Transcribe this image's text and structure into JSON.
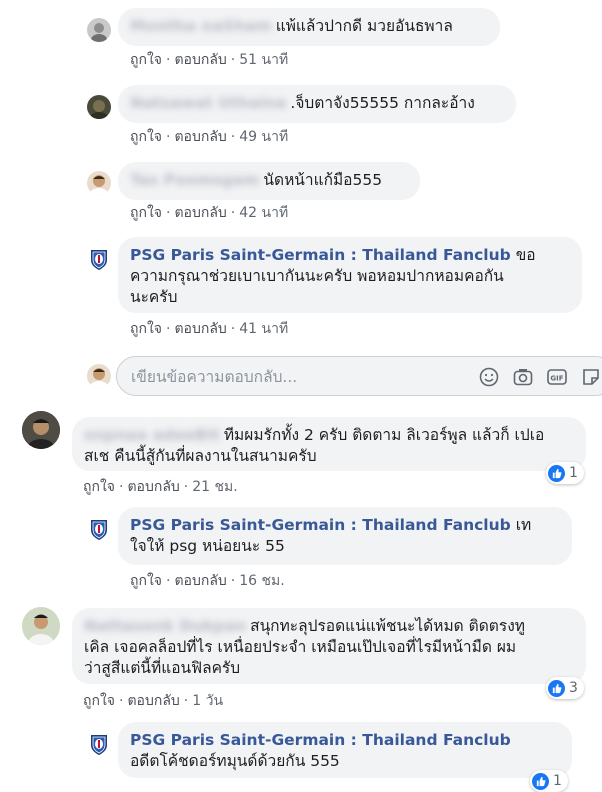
{
  "colors": {
    "link_blue": "#385898",
    "bubble_bg": "#f2f3f5",
    "like_blue": "#1877f2",
    "meta_gray": "#606770"
  },
  "page_name": "PSG Paris Saint-Germain : Thailand Fanclub",
  "actions": {
    "like": "ถูกใจ",
    "reply": "ตอบกลับ",
    "sep": "·"
  },
  "comments": [
    {
      "name": "Montha naSham",
      "text": "แพ้แล้วปากดี มวยอันธพาล",
      "time": "51 นาที"
    },
    {
      "name": "Natsawat Uthaina",
      "text": ".จ็บตาจัง55555 กากละอ้าง",
      "time": "49 นาที"
    },
    {
      "name": "Tas Poomsgam",
      "text": "นัดหน้าแก้มือ555",
      "time": "42 นาที"
    },
    {
      "text_l1": "ขอ",
      "text_l2": "ความกรุณาช่วยเบาเบากันนะครับ พอหอมปากหอมคอกัน",
      "text_l3": "นะครับ",
      "time": "41 นาที"
    },
    {
      "name": "snpnaa adeeBit",
      "text_l1": "ทีมผมรักทั้ง 2 ครับ ติดตาม ลิเวอร์พูล แล้วก็ เปเอ",
      "text_l2": "สเช คืนนี้สู้กันที่ผลงานในสนามครับ",
      "time": "21 ชม.",
      "likes": "1"
    },
    {
      "text_l1": "เท",
      "text_l2": "ใจให้ psg หน่อยนะ 55",
      "time": "16 ชม."
    },
    {
      "name": "Nattasonk Dukpan",
      "text_l1": "สนุกทะลุปรอดแน่แพ้ชนะได้หมด ติดตรงทู",
      "text_l2": "เคิล เจอคลล็อปที่ไร เหนื่อยประจำ เหมือนเป๊ปเจอที่ไรมีหน้ามืด ผม",
      "text_l3": "ว่าสูสีแต่นี้ที่แอนฟิลครับ",
      "time": "1 วัน",
      "likes": "3"
    },
    {
      "text_l2": "อดีตโค้ชดอร์ทมุนด์ด้วยกัน 555",
      "likes": "1"
    }
  ],
  "reply_box": {
    "placeholder": "เขียนข้อความตอบกลับ..."
  },
  "icons": [
    "emoji-icon",
    "camera-icon",
    "gif-icon",
    "sticker-icon",
    "like-thumb-icon",
    "psg-crest-icon"
  ]
}
